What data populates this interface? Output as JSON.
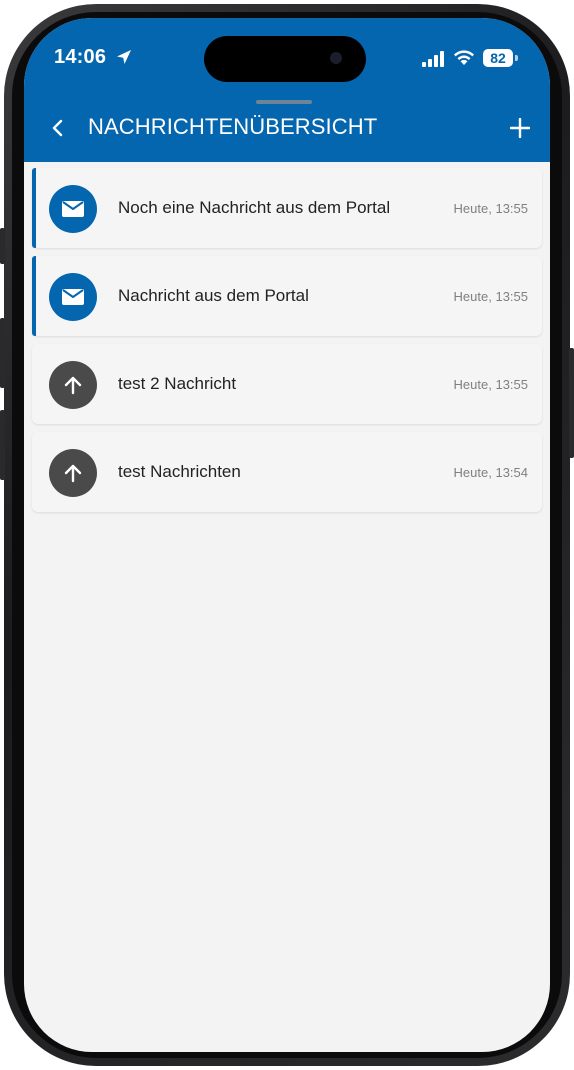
{
  "status_bar": {
    "time": "14:06",
    "battery": "82"
  },
  "header": {
    "title": "NACHRICHTENÜBERSICHT"
  },
  "messages": [
    {
      "text": "Noch eine Nachricht aus dem Portal",
      "time": "Heute, 13:55",
      "icon": "envelope-icon",
      "unread": true
    },
    {
      "text": "Nachricht aus dem Portal",
      "time": "Heute, 13:55",
      "icon": "envelope-icon",
      "unread": true
    },
    {
      "text": "test 2 Nachricht",
      "time": "Heute, 13:55",
      "icon": "arrow-up-icon",
      "unread": false
    },
    {
      "text": "test Nachrichten",
      "time": "Heute, 13:54",
      "icon": "arrow-up-icon",
      "unread": false
    }
  ],
  "colors": {
    "brand_blue": "#0566b0",
    "sent_gray": "#4a4a4a",
    "background": "#f3f3f3"
  }
}
